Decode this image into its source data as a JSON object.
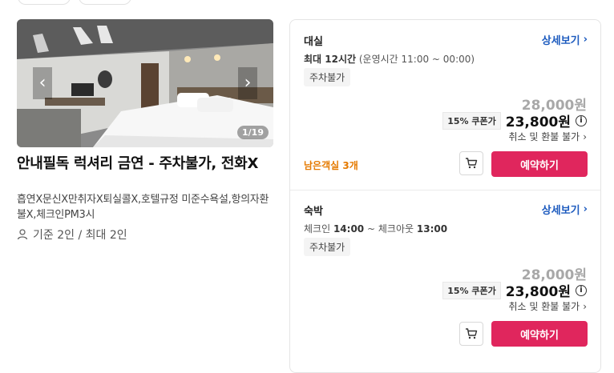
{
  "gallery": {
    "counter": "1/19",
    "prev_icon": "chevron-left-icon",
    "next_icon": "chevron-right-icon"
  },
  "hotel": {
    "title": "안내필독 럭셔리 금연 - 주차불가, 전화X",
    "description": "흡연X문신X만취자X퇴실콜X,호텔규정 미준수욕설,항의자환불X,체크인PM3시",
    "capacity": "기준 2인 / 최대 2인"
  },
  "rooms": [
    {
      "type": "대실",
      "detail_link": "상세보기",
      "hours_label": "최대 12시간",
      "hours_detail": "(운영시간 11:00 ~ 00:00)",
      "parking": "주차불가",
      "original_price": "28,000원",
      "coupon": "15% 쿠폰가",
      "final_price": "23,800원",
      "refund": "취소 및 환불 불가",
      "remaining": "남은객실 3개",
      "book_label": "예약하기"
    },
    {
      "type": "숙박",
      "detail_link": "상세보기",
      "checkin_label": "체크인",
      "checkin_time": "14:00",
      "checkout_label": "체크아웃",
      "checkout_time": "13:00",
      "parking": "주차불가",
      "original_price": "28,000원",
      "coupon": "15% 쿠폰가",
      "final_price": "23,800원",
      "refund": "취소 및 환불 불가",
      "book_label": "예약하기"
    }
  ],
  "colors": {
    "accent": "#e0265d",
    "link": "#1d5bbf",
    "remaining": "#e57a00"
  }
}
